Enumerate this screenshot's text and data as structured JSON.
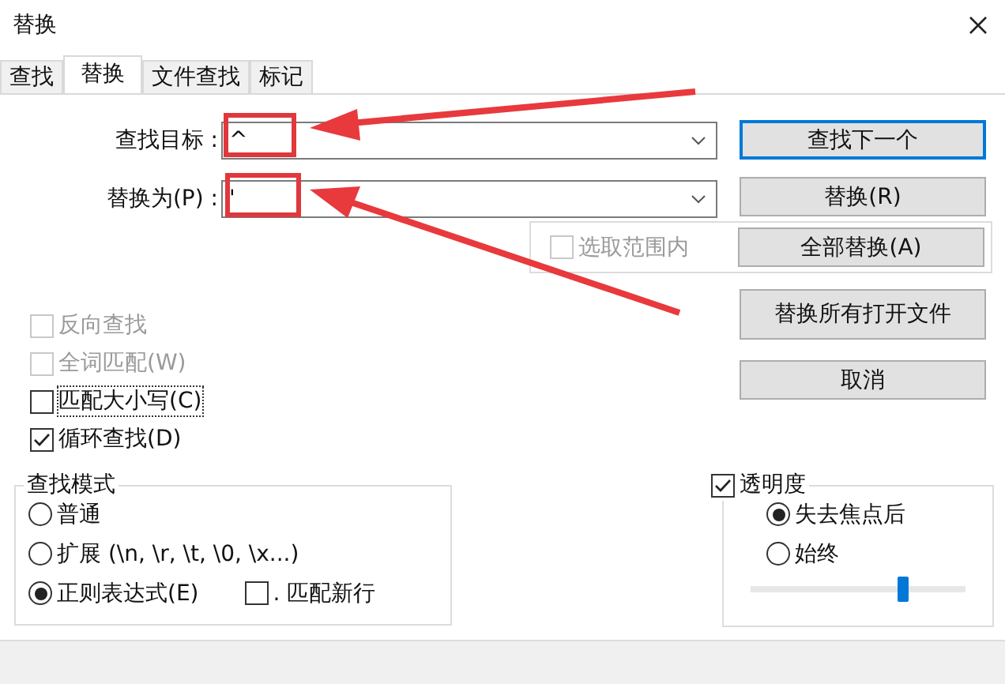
{
  "window": {
    "title": "替换"
  },
  "tabs": [
    {
      "label": "查找",
      "selected": false
    },
    {
      "label": "替换",
      "selected": true
    },
    {
      "label": "文件查找",
      "selected": false
    },
    {
      "label": "标记",
      "selected": false
    }
  ],
  "fields": [
    {
      "label": "查找目标 :",
      "value": "^"
    },
    {
      "label": "替换为(P) :",
      "value": "'"
    }
  ],
  "buttons": [
    {
      "label": "查找下一个",
      "default": true
    },
    {
      "label": "替换(R)",
      "default": false
    }
  ],
  "scope": {
    "label": "选取范围内",
    "checked": false,
    "disabled": true,
    "button": "全部替换(A)"
  },
  "more_buttons": [
    {
      "label": "替换所有打开文件",
      "tall": true
    },
    {
      "label": "取消",
      "tall": false
    }
  ],
  "options": [
    {
      "label": "反向查找",
      "checked": false,
      "disabled": true,
      "focused": false
    },
    {
      "label": "全词匹配(W)",
      "checked": false,
      "disabled": true,
      "focused": false
    },
    {
      "label": "匹配大小写(C)",
      "checked": false,
      "disabled": false,
      "focused": true
    },
    {
      "label": "循环查找(D)",
      "checked": true,
      "disabled": false,
      "focused": false
    }
  ],
  "search_mode": {
    "title": "查找模式",
    "options": [
      {
        "label": "普通",
        "selected": false
      },
      {
        "label": "扩展 (\\n, \\r, \\t, \\0, \\x...)",
        "selected": false
      },
      {
        "label": "正则表达式(E)",
        "selected": true
      }
    ],
    "dot_newline": {
      "label": ". 匹配新行",
      "checked": false
    }
  },
  "transparency": {
    "label": "透明度",
    "checked": true,
    "options": [
      {
        "label": "失去焦点后",
        "selected": true
      },
      {
        "label": "始终",
        "selected": false
      }
    ],
    "level": 0.71
  }
}
